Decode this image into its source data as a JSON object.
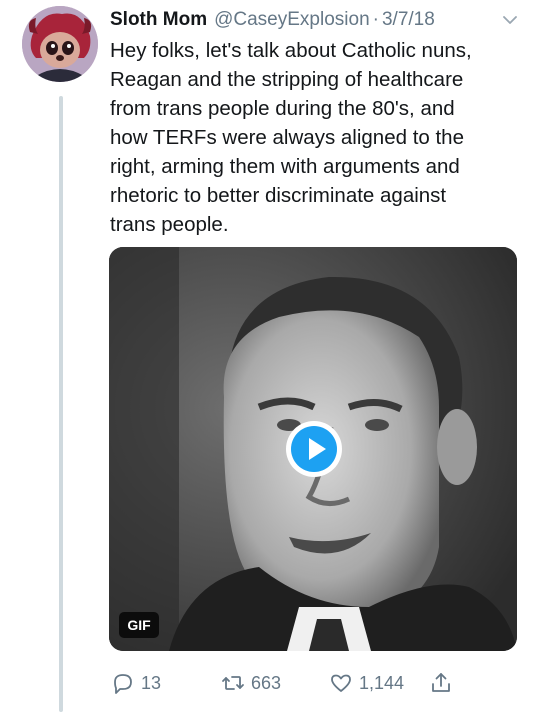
{
  "tweet": {
    "author_name": "Sloth Mom",
    "handle": "@CaseyExplosion",
    "separator": "·",
    "date": "3/7/18",
    "text_lines": [
      "Hey folks, let's talk about Catholic nuns,",
      "Reagan and the stripping of healthcare",
      "from trans people during the 80's, and",
      "how TERFs were always aligned to the",
      "right, arming them with arguments and",
      "rhetoric to better discriminate against",
      "trans people."
    ]
  },
  "media": {
    "badge": "GIF",
    "icon": "play-icon"
  },
  "actions": {
    "reply_count": "13",
    "retweet_count": "663",
    "like_count": "1,144"
  },
  "colors": {
    "accent": "#1da1f2",
    "secondary_text": "#657786",
    "thread_line": "#cfd9de"
  }
}
